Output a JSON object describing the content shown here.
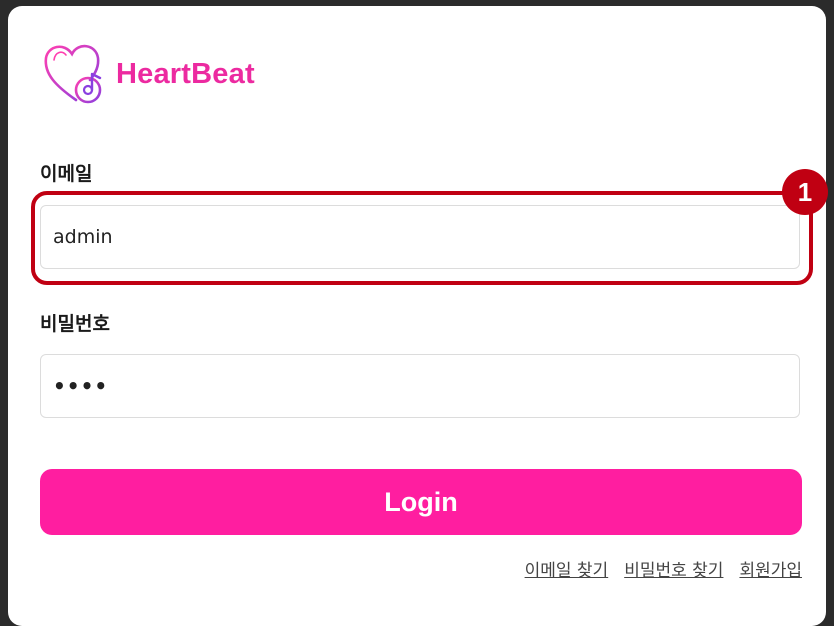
{
  "brand": {
    "name": "HeartBeat",
    "color": "#ec2aa0",
    "icon": "heart-music-note-icon"
  },
  "email": {
    "label": "이메일",
    "value": "admin"
  },
  "password": {
    "label": "비밀번호",
    "value": "••••"
  },
  "annotation": {
    "number": "1",
    "color": "#c00012"
  },
  "login_button": {
    "label": "Login",
    "color": "#ff1ea0"
  },
  "links": {
    "find_email": "이메일 찾기",
    "find_password": "비밀번호 찾기",
    "signup": "회원가입"
  }
}
